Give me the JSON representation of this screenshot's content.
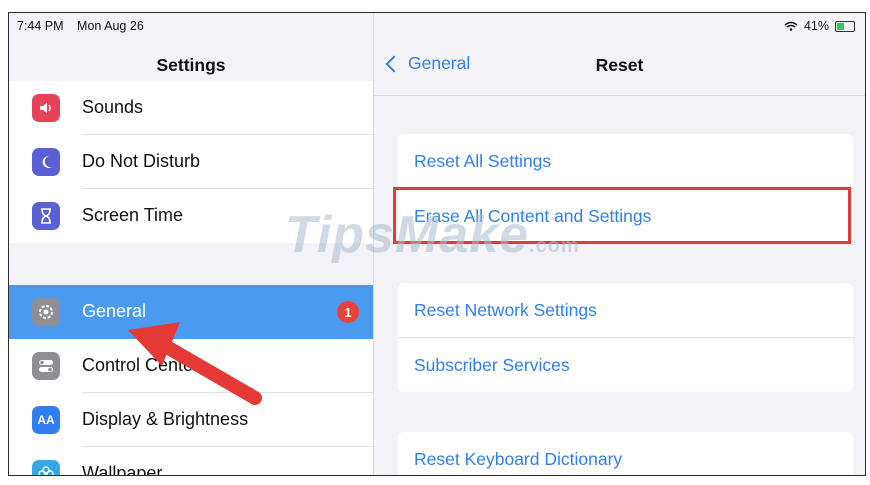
{
  "status": {
    "time": "7:44 PM",
    "date": "Mon Aug 26",
    "battery": "41%"
  },
  "left": {
    "title": "Settings",
    "items": [
      {
        "label": "Sounds",
        "icon": "speaker-icon",
        "color": "#e8415a"
      },
      {
        "label": "Do Not Disturb",
        "icon": "moon-icon",
        "color": "#5b5fd6"
      },
      {
        "label": "Screen Time",
        "icon": "hourglass-icon",
        "color": "#5b5fd6"
      },
      {
        "label": "General",
        "icon": "gear-icon",
        "color": "#8e8e93",
        "badge": "1",
        "selected": true
      },
      {
        "label": "Control Center",
        "icon": "toggles-icon",
        "color": "#8e8e93"
      },
      {
        "label": "Display & Brightness",
        "icon": "display-icon",
        "color": "#2f7ff0"
      },
      {
        "label": "Wallpaper",
        "icon": "flower-icon",
        "color": "#35a7e6"
      }
    ]
  },
  "right": {
    "back_label": "General",
    "title": "Reset",
    "group1": [
      "Reset All Settings",
      "Erase All Content and Settings"
    ],
    "group2": [
      "Reset Network Settings",
      "Subscriber Services"
    ],
    "group3": [
      "Reset Keyboard Dictionary"
    ]
  },
  "watermark": {
    "main": "TipsMake",
    "suffix": ".com"
  },
  "colors": {
    "accent": "#2f7ff0",
    "selection": "#4a9bf0",
    "highlight": "#e53935",
    "badge": "#e8413a"
  }
}
